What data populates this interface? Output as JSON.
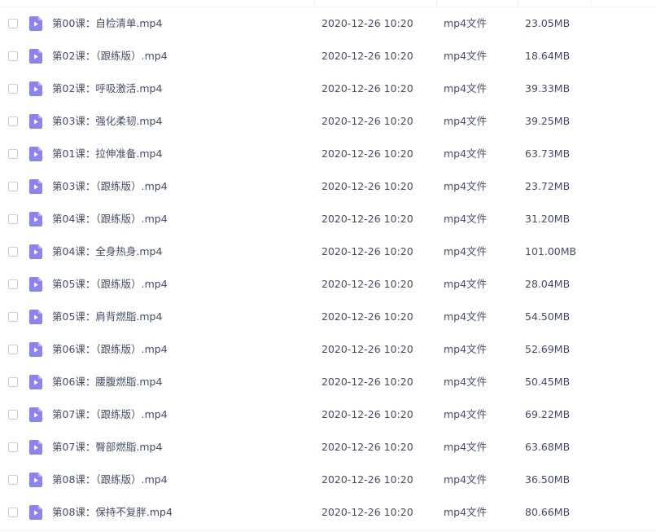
{
  "files": [
    {
      "name": "第00课：自检清单.mp4",
      "date": "2020-12-26 10:20",
      "type": "mp4文件",
      "size": "23.05MB"
    },
    {
      "name": "第02课：（跟练版）.mp4",
      "date": "2020-12-26 10:20",
      "type": "mp4文件",
      "size": "18.64MB"
    },
    {
      "name": "第02课：呼吸激活.mp4",
      "date": "2020-12-26 10:20",
      "type": "mp4文件",
      "size": "39.33MB"
    },
    {
      "name": "第03课：强化柔韧.mp4",
      "date": "2020-12-26 10:20",
      "type": "mp4文件",
      "size": "39.25MB"
    },
    {
      "name": "第01课：拉伸准备.mp4",
      "date": "2020-12-26 10:20",
      "type": "mp4文件",
      "size": "63.73MB"
    },
    {
      "name": "第03课：（跟练版）.mp4",
      "date": "2020-12-26 10:20",
      "type": "mp4文件",
      "size": "23.72MB"
    },
    {
      "name": "第04课：（跟练版）.mp4",
      "date": "2020-12-26 10:20",
      "type": "mp4文件",
      "size": "31.20MB"
    },
    {
      "name": "第04课：全身热身.mp4",
      "date": "2020-12-26 10:20",
      "type": "mp4文件",
      "size": "101.00MB"
    },
    {
      "name": "第05课：（跟练版）.mp4",
      "date": "2020-12-26 10:20",
      "type": "mp4文件",
      "size": "28.04MB"
    },
    {
      "name": "第05课：肩背燃脂.mp4",
      "date": "2020-12-26 10:20",
      "type": "mp4文件",
      "size": "54.50MB"
    },
    {
      "name": "第06课：（跟练版）.mp4",
      "date": "2020-12-26 10:20",
      "type": "mp4文件",
      "size": "52.69MB"
    },
    {
      "name": "第06课：腰腹燃脂.mp4",
      "date": "2020-12-26 10:20",
      "type": "mp4文件",
      "size": "50.45MB"
    },
    {
      "name": "第07课：（跟练版）.mp4",
      "date": "2020-12-26 10:20",
      "type": "mp4文件",
      "size": "69.22MB"
    },
    {
      "name": "第07课：臀部燃脂.mp4",
      "date": "2020-12-26 10:20",
      "type": "mp4文件",
      "size": "63.68MB"
    },
    {
      "name": "第08课：（跟练版）.mp4",
      "date": "2020-12-26 10:20",
      "type": "mp4文件",
      "size": "36.50MB"
    },
    {
      "name": "第08课：保持不复胖.mp4",
      "date": "2020-12-26 10:20",
      "type": "mp4文件",
      "size": "80.66MB"
    }
  ],
  "icon": "video-file-icon",
  "colors": {
    "icon_fill": "#8a84f0",
    "icon_fold": "#b9b4fa",
    "text": "#424e67"
  }
}
